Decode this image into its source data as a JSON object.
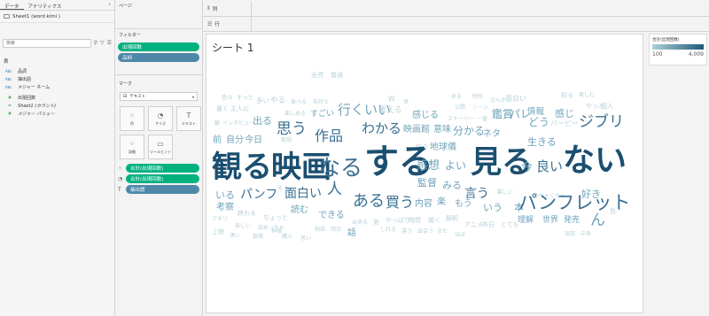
{
  "data_pane": {
    "tabs": [
      "データ",
      "アナリティクス"
    ],
    "collapse_icon": "‹",
    "datasource": "Sheet1 (word kimi )",
    "search_placeholder": "検索",
    "section_label": "表",
    "dimensions": [
      {
        "type": "Abc",
        "name": "品詞",
        "italic": false
      },
      {
        "type": "Abc",
        "name": "抽出語",
        "italic": false
      },
      {
        "type": "Abc",
        "name": "メジャー ネーム",
        "italic": false
      }
    ],
    "measures": [
      {
        "type": "#",
        "name": "出現回数",
        "italic": false
      },
      {
        "type": "=",
        "name": "Sheet1 (カウント)",
        "italic": true
      },
      {
        "type": "#",
        "name": "メジャー バリュー",
        "italic": true
      }
    ]
  },
  "shelves": {
    "pages_label": "ページ",
    "filters_label": "フィルター",
    "filters": [
      {
        "label": "出現回数",
        "color": "green"
      },
      {
        "label": "品詞",
        "color": "blue"
      }
    ],
    "marks_label": "マーク",
    "mark_type": "テキスト",
    "mark_buttons": [
      {
        "glyph": "⁘",
        "label": "色",
        "name": "color-icon"
      },
      {
        "glyph": "◔",
        "label": "サイズ",
        "name": "size-icon"
      },
      {
        "glyph": "T",
        "label": "テキスト",
        "name": "text-icon"
      },
      {
        "glyph": "⁘",
        "label": "詳細",
        "name": "detail-icon"
      },
      {
        "glyph": "▭",
        "label": "ツールヒント",
        "name": "tooltip-icon"
      }
    ],
    "mark_pills": [
      {
        "icon": "⁘",
        "label": "合計(出現回数)",
        "color": "green"
      },
      {
        "icon": "◔",
        "label": "合計(出現回数)",
        "color": "green"
      },
      {
        "icon": "T",
        "label": "抽出語",
        "color": "blue"
      }
    ],
    "columns_label": "列",
    "rows_label": "行"
  },
  "sheet": {
    "title": "シート 1"
  },
  "legend": {
    "title": "合計(出現回数)",
    "min": "100",
    "max": "4,009"
  },
  "colors": {
    "light": "#b7d1d9",
    "mid": "#6fa3ba",
    "dark": "#3a6f92",
    "darkest": "#1b4f70"
  },
  "words": [
    {
      "t": "全然",
      "level": "light"
    },
    {
      "t": "普通",
      "level": "light"
    },
    {
      "t": "色々",
      "level": "light"
    },
    {
      "t": "すっと",
      "level": "light"
    },
    {
      "t": "多い",
      "level": "light"
    },
    {
      "t": "やる",
      "level": "light"
    },
    {
      "t": "食べる",
      "level": "light"
    },
    {
      "t": "気持ち",
      "level": "light"
    },
    {
      "t": "W",
      "level": "light"
    },
    {
      "t": "良",
      "level": "light"
    },
    {
      "t": "来る",
      "level": "light"
    },
    {
      "t": "制作",
      "level": "light"
    },
    {
      "t": "なんか",
      "level": "light"
    },
    {
      "t": "面白い",
      "level": "light"
    },
    {
      "t": "知る",
      "level": "light"
    },
    {
      "t": "楽しむ",
      "level": "light"
    },
    {
      "t": "書く",
      "level": "light"
    },
    {
      "t": "主人公",
      "level": "light"
    },
    {
      "t": "楽しめる",
      "level": "light"
    },
    {
      "t": "すごい",
      "level": "mid"
    },
    {
      "t": "行くいい",
      "level": "mid"
    },
    {
      "t": "考える",
      "level": "light"
    },
    {
      "t": "感じる",
      "level": "mid"
    },
    {
      "t": "ストーリー",
      "level": "light"
    },
    {
      "t": "一番",
      "level": "light"
    },
    {
      "t": "公開",
      "level": "light"
    },
    {
      "t": "シーン",
      "level": "light"
    },
    {
      "t": "鑑賞",
      "level": "mid"
    },
    {
      "t": "パレ",
      "level": "mid"
    },
    {
      "t": "情報",
      "level": "mid"
    },
    {
      "t": "感じ",
      "level": "mid"
    },
    {
      "t": "やっと",
      "level": "light"
    },
    {
      "t": "個人",
      "level": "light"
    },
    {
      "t": "観",
      "level": "light"
    },
    {
      "t": "インタビュー",
      "level": "light"
    },
    {
      "t": "出る",
      "level": "mid"
    },
    {
      "t": "思う",
      "level": "dark"
    },
    {
      "t": "作品",
      "level": "dark"
    },
    {
      "t": "わかる",
      "level": "dark"
    },
    {
      "t": "映画館",
      "level": "mid"
    },
    {
      "t": "意味",
      "level": "mid"
    },
    {
      "t": "分かる",
      "level": "mid"
    },
    {
      "t": "ネタ",
      "level": "mid"
    },
    {
      "t": "どう",
      "level": "mid"
    },
    {
      "t": "パーピー",
      "level": "light"
    },
    {
      "t": "ジブリ",
      "level": "dark"
    },
    {
      "t": "前",
      "level": "mid"
    },
    {
      "t": "自分",
      "level": "mid"
    },
    {
      "t": "今日",
      "level": "mid"
    },
    {
      "t": "解説",
      "level": "light"
    },
    {
      "t": "作る",
      "level": "light"
    },
    {
      "t": "地球儀",
      "level": "mid"
    },
    {
      "t": "生きる",
      "level": "mid"
    },
    {
      "t": "観る",
      "level": "darkest"
    },
    {
      "t": "映画",
      "level": "darkest"
    },
    {
      "t": "なる",
      "level": "dark"
    },
    {
      "t": "する",
      "level": "darkest"
    },
    {
      "t": "感想",
      "level": "mid"
    },
    {
      "t": "よい",
      "level": "mid"
    },
    {
      "t": "見る",
      "level": "darkest"
    },
    {
      "t": "今",
      "level": "mid"
    },
    {
      "t": "良い",
      "level": "dark"
    },
    {
      "t": "ない",
      "level": "darkest"
    },
    {
      "t": "いる",
      "level": "mid"
    },
    {
      "t": "パンフ",
      "level": "dark"
    },
    {
      "t": "そう",
      "level": "light"
    },
    {
      "t": "面白い",
      "level": "dark"
    },
    {
      "t": "人",
      "level": "dark"
    },
    {
      "t": "監督",
      "level": "mid"
    },
    {
      "t": "みる",
      "level": "mid"
    },
    {
      "t": "言う",
      "level": "dark"
    },
    {
      "t": "難しい",
      "level": "light"
    },
    {
      "t": "めちゃくちゃ",
      "level": "light"
    },
    {
      "t": "好き",
      "level": "mid"
    },
    {
      "t": "考察",
      "level": "mid"
    },
    {
      "t": "読む",
      "level": "mid"
    },
    {
      "t": "ある",
      "level": "dark"
    },
    {
      "t": "買う",
      "level": "dark"
    },
    {
      "t": "内容",
      "level": "mid"
    },
    {
      "t": "楽",
      "level": "mid"
    },
    {
      "t": "もう",
      "level": "mid"
    },
    {
      "t": "いう",
      "level": "mid"
    },
    {
      "t": "本",
      "level": "mid"
    },
    {
      "t": "パンフレット",
      "level": "dark"
    },
    {
      "t": "アオリ",
      "level": "light"
    },
    {
      "t": "終わる",
      "level": "light"
    },
    {
      "t": "ちょっと",
      "level": "light"
    },
    {
      "t": "できる",
      "level": "mid"
    },
    {
      "t": "やっぱり",
      "level": "light"
    },
    {
      "t": "時間",
      "level": "light"
    },
    {
      "t": "聞く",
      "level": "light"
    },
    {
      "t": "解釈",
      "level": "light"
    },
    {
      "t": "ん",
      "level": "mid"
    },
    {
      "t": "島",
      "level": "light"
    },
    {
      "t": "楽しい",
      "level": "light"
    },
    {
      "t": "読めっちゃ",
      "level": "light"
    },
    {
      "t": "出来る",
      "level": "light"
    },
    {
      "t": "気",
      "level": "light"
    },
    {
      "t": "アニメ",
      "level": "light"
    },
    {
      "t": "昨日",
      "level": "light"
    },
    {
      "t": "とても",
      "level": "light"
    },
    {
      "t": "理解",
      "level": "mid"
    },
    {
      "t": "世界",
      "level": "mid"
    },
    {
      "t": "発売",
      "level": "mid"
    },
    {
      "t": "上映",
      "level": "light"
    },
    {
      "t": "凄い",
      "level": "light"
    },
    {
      "t": "劇場",
      "level": "light"
    },
    {
      "t": "購入",
      "level": "light"
    },
    {
      "t": "物語",
      "level": "light"
    },
    {
      "t": "明日",
      "level": "light"
    },
    {
      "t": "話",
      "level": "mid"
    },
    {
      "t": "しれる",
      "level": "light"
    },
    {
      "t": "違う",
      "level": "light"
    },
    {
      "t": "出会う",
      "level": "light"
    },
    {
      "t": "まだ",
      "level": "light"
    },
    {
      "t": "ほぼ",
      "level": "light"
    },
    {
      "t": "宮田",
      "level": "light"
    },
    {
      "t": "中身",
      "level": "light"
    },
    {
      "t": "神様",
      "level": "light"
    },
    {
      "t": "思い",
      "level": "light"
    }
  ]
}
